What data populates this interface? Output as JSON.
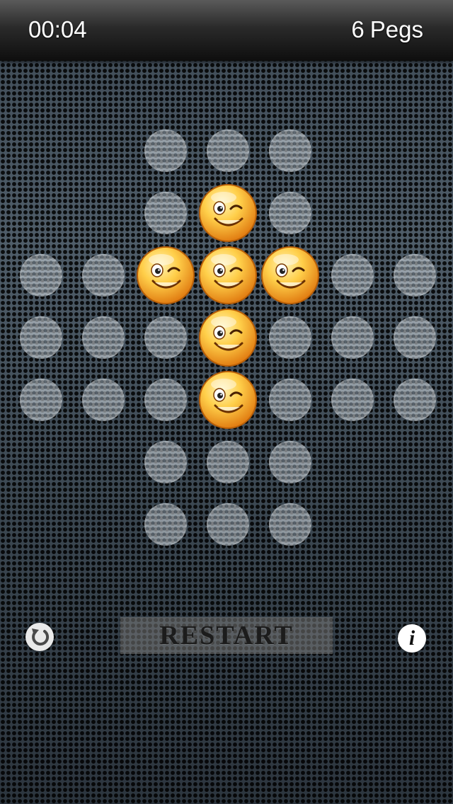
{
  "header": {
    "timer": "00:04",
    "peg_count": "6",
    "peg_label": "Pegs"
  },
  "board": {
    "rows": 7,
    "cols": 7,
    "layout": [
      [
        null,
        null,
        0,
        0,
        0,
        null,
        null
      ],
      [
        null,
        null,
        0,
        1,
        0,
        null,
        null
      ],
      [
        0,
        0,
        1,
        1,
        1,
        0,
        0
      ],
      [
        0,
        0,
        0,
        1,
        0,
        0,
        0
      ],
      [
        0,
        0,
        0,
        1,
        0,
        0,
        0
      ],
      [
        null,
        null,
        0,
        0,
        0,
        null,
        null
      ],
      [
        null,
        null,
        0,
        0,
        0,
        null,
        null
      ]
    ],
    "peg_icon": "winking-smiley-icon",
    "peg_color": "#f5a623"
  },
  "controls": {
    "undo_icon": "undo-icon",
    "restart_label": "RESTART",
    "info_icon": "info-icon",
    "info_glyph": "i"
  }
}
